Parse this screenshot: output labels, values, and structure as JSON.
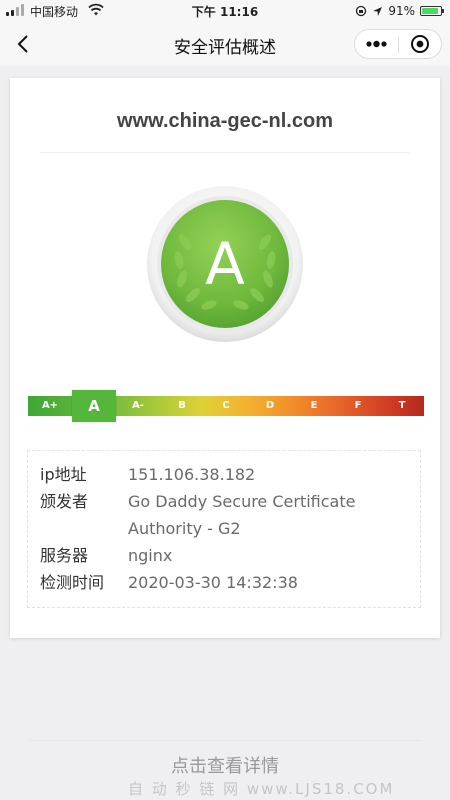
{
  "status_bar": {
    "carrier": "中国移动",
    "time": "下午 11:16",
    "battery_percent": "91%",
    "battery_level": 0.91,
    "icons": [
      "signal-icon",
      "wifi-icon",
      "screen-lock-icon",
      "location-icon",
      "battery-icon"
    ]
  },
  "nav": {
    "title": "安全评估概述",
    "icons": [
      "back-arrow-icon",
      "more-dots-icon",
      "close-circle-icon"
    ]
  },
  "report": {
    "domain": "www.china-gec-nl.com",
    "grade": "A",
    "grade_scale": [
      "A+",
      "A",
      "A-",
      "B",
      "C",
      "D",
      "E",
      "F",
      "T"
    ],
    "active_grade_index": 1,
    "colors": {
      "badge_green": "#6fb93d",
      "active_grade": "#54b73b",
      "scale_start": "#3ea735",
      "scale_end": "#b42a1d"
    }
  },
  "info": {
    "ip_label": "ip地址",
    "ip_value": "151.106.38.182",
    "issuer_label": "颁发者",
    "issuer_value_line1": "Go Daddy Secure Certificate",
    "issuer_value_line2": "Authority - G2",
    "server_label": "服务器",
    "server_value": "nginx",
    "time_label": "检测时间",
    "time_value": "2020-03-30 14:32:38"
  },
  "footer": {
    "details_link": "点击查看详情",
    "watermark": "自 动 秒 链 网   www.LJS18.COM"
  }
}
